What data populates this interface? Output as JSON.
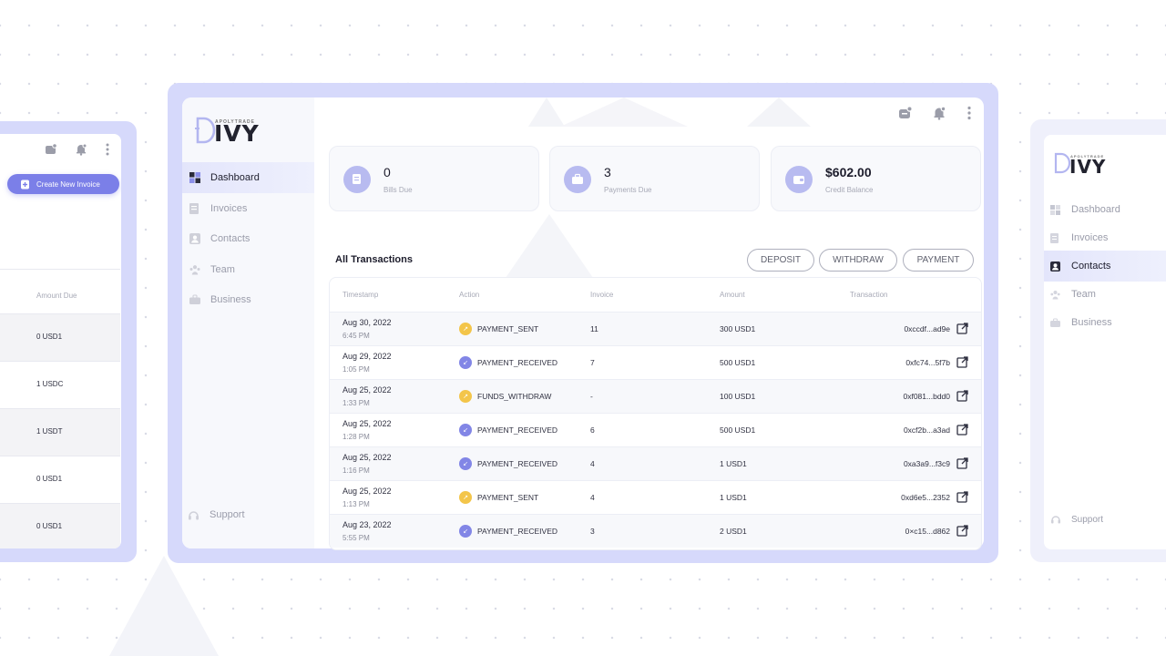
{
  "brand": {
    "name": "IVY",
    "initial": "D",
    "tagline": "APOLYTRADE"
  },
  "nav": {
    "dashboard": "Dashboard",
    "invoices": "Invoices",
    "contacts": "Contacts",
    "team": "Team",
    "business": "Business",
    "support": "Support"
  },
  "cards": [
    {
      "value": "0",
      "label": "Bills Due"
    },
    {
      "value": "3",
      "label": "Payments Due"
    },
    {
      "value": "$602.00",
      "label": "Credit Balance"
    }
  ],
  "transactions": {
    "title": "All Transactions",
    "buttons": {
      "deposit": "DEPOSIT",
      "withdraw": "WITHDRAW",
      "payment": "PAYMENT"
    },
    "columns": {
      "timestamp": "Timestamp",
      "action": "Action",
      "invoice": "Invoice",
      "amount": "Amount",
      "transaction": "Transaction"
    },
    "rows": [
      {
        "date": "Aug 30, 2022",
        "time": "6:45 PM",
        "action": "PAYMENT_SENT",
        "invoice": "11",
        "amount": "300  USD1",
        "hash": "0xccdf...ad9e"
      },
      {
        "date": "Aug 29, 2022",
        "time": "1:05 PM",
        "action": "PAYMENT_RECEIVED",
        "invoice": "7",
        "amount": "500  USD1",
        "hash": "0xfc74...5f7b"
      },
      {
        "date": "Aug 25, 2022",
        "time": "1:33 PM",
        "action": "FUNDS_WITHDRAW",
        "invoice": "-",
        "amount": "100  USD1",
        "hash": "0xf081...bdd0"
      },
      {
        "date": "Aug 25, 2022",
        "time": "1:28 PM",
        "action": "PAYMENT_RECEIVED",
        "invoice": "6",
        "amount": "500  USD1",
        "hash": "0xcf2b...a3ad"
      },
      {
        "date": "Aug 25, 2022",
        "time": "1:16 PM",
        "action": "PAYMENT_RECEIVED",
        "invoice": "4",
        "amount": "1  USD1",
        "hash": "0xa3a9...f3c9"
      },
      {
        "date": "Aug 25, 2022",
        "time": "1:13 PM",
        "action": "PAYMENT_SENT",
        "invoice": "4",
        "amount": "1  USD1",
        "hash": "0xd6e5...2352"
      },
      {
        "date": "Aug 23, 2022",
        "time": "5:55 PM",
        "action": "PAYMENT_RECEIVED",
        "invoice": "3",
        "amount": "2  USD1",
        "hash": "0×c15...d862"
      }
    ]
  },
  "left_panel": {
    "create_button": "Create New Invoice",
    "amount_due_header": "Amount Due",
    "rows": [
      "0 USD1",
      "1 USDC",
      "1 USDT",
      "0 USD1",
      "0 USD1"
    ]
  },
  "colors": {
    "accent": "#7b7fe8",
    "frame": "#d6d9fb",
    "yellow": "#f3c54a",
    "purple": "#8286e6"
  }
}
